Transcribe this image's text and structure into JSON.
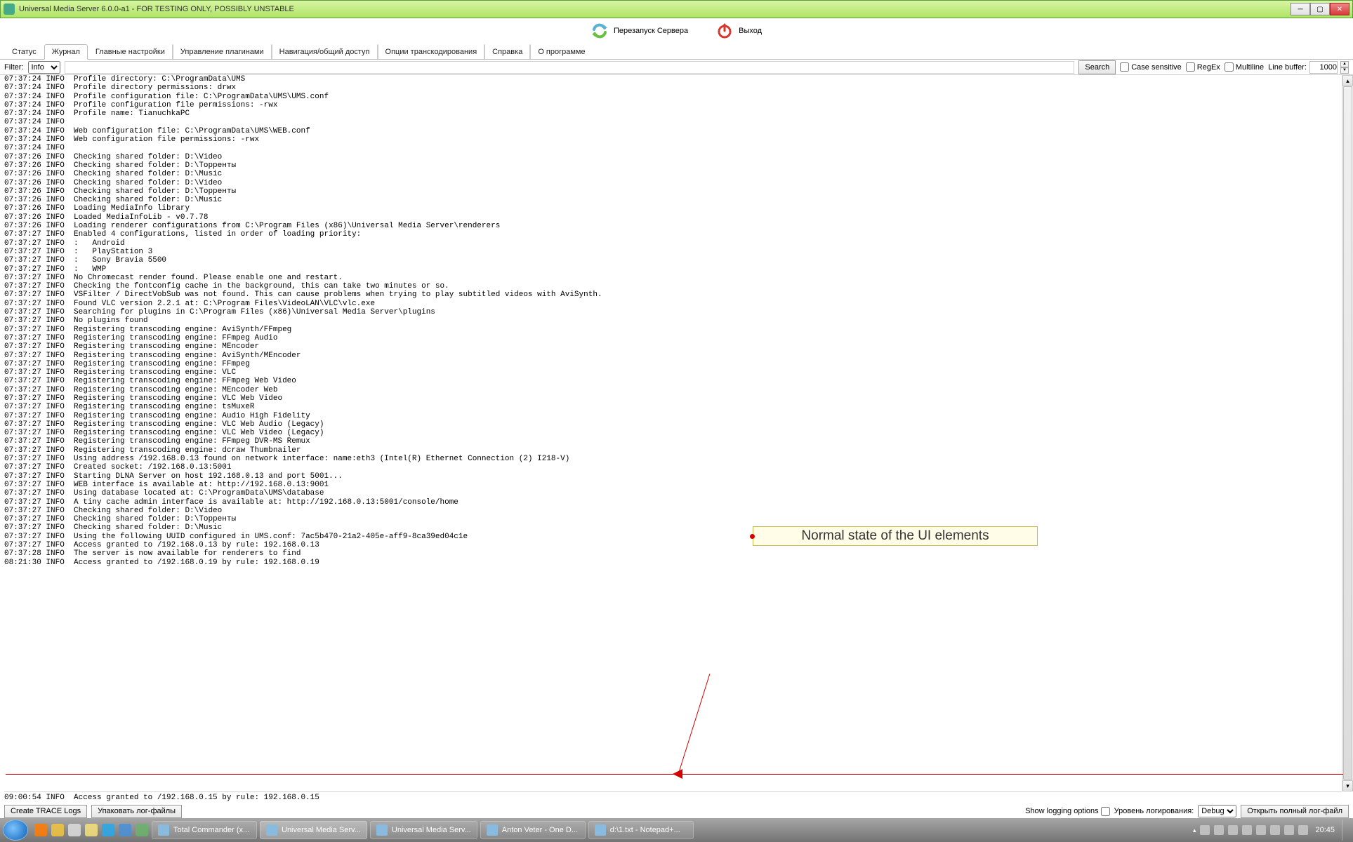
{
  "window": {
    "title": "Universal Media Server 6.0.0-a1 - FOR TESTING ONLY, POSSIBLY UNSTABLE"
  },
  "toolbar": {
    "restart_label": "Перезапуск Сервера",
    "exit_label": "Выход"
  },
  "tabs": [
    "Статус",
    "Журнал",
    "Главные настройки",
    "Управление плагинами",
    "Навигация/общий доступ",
    "Опции транскодирования",
    "Справка",
    "О программе"
  ],
  "active_tab_index": 1,
  "filter": {
    "label": "Filter:",
    "level": "Info",
    "search_btn": "Search",
    "case_label": "Case sensitive",
    "regex_label": "RegEx",
    "multiline_label": "Multiline",
    "linebuf_label": "Line buffer:",
    "linebuf_value": "1000"
  },
  "log_lines": [
    "07:37:24 INFO  Profile directory: C:\\ProgramData\\UMS",
    "07:37:24 INFO  Profile directory permissions: drwx",
    "07:37:24 INFO  Profile configuration file: C:\\ProgramData\\UMS\\UMS.conf",
    "07:37:24 INFO  Profile configuration file permissions: -rwx",
    "07:37:24 INFO  Profile name: TianuchkaPC",
    "07:37:24 INFO  ",
    "07:37:24 INFO  Web configuration file: C:\\ProgramData\\UMS\\WEB.conf",
    "07:37:24 INFO  Web configuration file permissions: -rwx",
    "07:37:24 INFO  ",
    "07:37:26 INFO  Checking shared folder: D:\\Video",
    "07:37:26 INFO  Checking shared folder: D:\\Торренты",
    "07:37:26 INFO  Checking shared folder: D:\\Music",
    "07:37:26 INFO  Checking shared folder: D:\\Video",
    "07:37:26 INFO  Checking shared folder: D:\\Торренты",
    "07:37:26 INFO  Checking shared folder: D:\\Music",
    "07:37:26 INFO  Loading MediaInfo library",
    "07:37:26 INFO  Loaded MediaInfoLib - v0.7.78",
    "07:37:26 INFO  Loading renderer configurations from C:\\Program Files (x86)\\Universal Media Server\\renderers",
    "07:37:27 INFO  Enabled 4 configurations, listed in order of loading priority:",
    "07:37:27 INFO  :   Android",
    "07:37:27 INFO  :   PlayStation 3",
    "07:37:27 INFO  :   Sony Bravia 5500",
    "07:37:27 INFO  :   WMP",
    "07:37:27 INFO  No Chromecast render found. Please enable one and restart.",
    "07:37:27 INFO  Checking the fontconfig cache in the background, this can take two minutes or so.",
    "07:37:27 INFO  VSFilter / DirectVobSub was not found. This can cause problems when trying to play subtitled videos with AviSynth.",
    "07:37:27 INFO  Found VLC version 2.2.1 at: C:\\Program Files\\VideoLAN\\VLC\\vlc.exe",
    "07:37:27 INFO  Searching for plugins in C:\\Program Files (x86)\\Universal Media Server\\plugins",
    "07:37:27 INFO  No plugins found",
    "07:37:27 INFO  Registering transcoding engine: AviSynth/FFmpeg",
    "07:37:27 INFO  Registering transcoding engine: FFmpeg Audio",
    "07:37:27 INFO  Registering transcoding engine: MEncoder",
    "07:37:27 INFO  Registering transcoding engine: AviSynth/MEncoder",
    "07:37:27 INFO  Registering transcoding engine: FFmpeg",
    "07:37:27 INFO  Registering transcoding engine: VLC",
    "07:37:27 INFO  Registering transcoding engine: FFmpeg Web Video",
    "07:37:27 INFO  Registering transcoding engine: MEncoder Web",
    "07:37:27 INFO  Registering transcoding engine: VLC Web Video",
    "07:37:27 INFO  Registering transcoding engine: tsMuxeR",
    "07:37:27 INFO  Registering transcoding engine: Audio High Fidelity",
    "07:37:27 INFO  Registering transcoding engine: VLC Web Audio (Legacy)",
    "07:37:27 INFO  Registering transcoding engine: VLC Web Video (Legacy)",
    "07:37:27 INFO  Registering transcoding engine: FFmpeg DVR-MS Remux",
    "07:37:27 INFO  Registering transcoding engine: dcraw Thumbnailer",
    "07:37:27 INFO  Using address /192.168.0.13 found on network interface: name:eth3 (Intel(R) Ethernet Connection (2) I218-V)",
    "07:37:27 INFO  Created socket: /192.168.0.13:5001",
    "07:37:27 INFO  Starting DLNA Server on host 192.168.0.13 and port 5001...",
    "07:37:27 INFO  WEB interface is available at: http://192.168.0.13:9001",
    "07:37:27 INFO  Using database located at: C:\\ProgramData\\UMS\\database",
    "07:37:27 INFO  A tiny cache admin interface is available at: http://192.168.0.13:5001/console/home",
    "07:37:27 INFO  Checking shared folder: D:\\Video",
    "07:37:27 INFO  Checking shared folder: D:\\Торренты",
    "07:37:27 INFO  Checking shared folder: D:\\Music",
    "07:37:27 INFO  Using the following UUID configured in UMS.conf: 7ac5b470-21a2-405e-aff9-8ca39ed04c1e",
    "07:37:27 INFO  Access granted to /192.168.0.13 by rule: 192.168.0.13",
    "07:37:28 INFO  The server is now available for renderers to find",
    "08:21:30 INFO  Access granted to /192.168.0.19 by rule: 192.168.0.19"
  ],
  "status_line": "09:00:54 INFO  Access granted to /192.168.0.15 by rule: 192.168.0.15",
  "bottom": {
    "create_trace": "Create TRACE Logs",
    "pack_logs": "Упаковать лог-файлы",
    "show_opts": "Show logging options",
    "log_level_label": "Уровень логирования:",
    "log_level_value": "Debug",
    "open_full": "Открыть полный лог-файл"
  },
  "annotation": {
    "text": "Normal state of the UI elements"
  },
  "taskbar": {
    "items": [
      {
        "label": "Total Commander (x...",
        "active": false
      },
      {
        "label": "Universal Media Serv...",
        "active": true
      },
      {
        "label": "Universal Media Serv...",
        "active": false
      },
      {
        "label": "Anton Veter - One D...",
        "active": false
      },
      {
        "label": "d:\\1.txt - Notepad+...",
        "active": false
      }
    ],
    "clock": "20:45"
  }
}
